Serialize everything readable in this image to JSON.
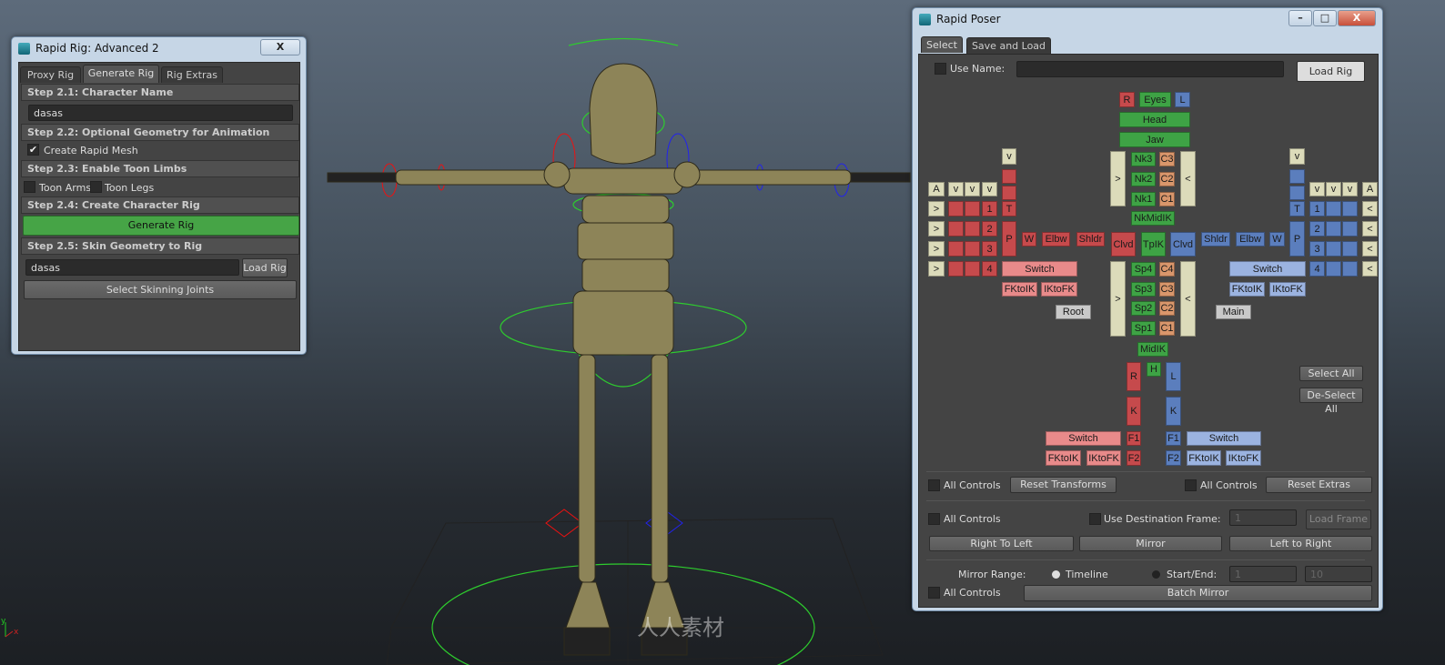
{
  "viewport": {
    "watermark": "人人素材",
    "axis_x": "x",
    "axis_y": "y"
  },
  "rig_window": {
    "title": "Rapid Rig: Advanced 2",
    "close": "X",
    "tabs": [
      {
        "label": "Proxy Rig"
      },
      {
        "label": "Generate Rig",
        "active": true
      },
      {
        "label": "Rig Extras"
      }
    ],
    "step1": "Step 2.1: Character Name",
    "name_value": "dasas",
    "step2": "Step 2.2: Optional Geometry for Animation",
    "rapid_mesh": "Create Rapid Mesh",
    "rapid_mesh_checked": true,
    "step3": "Step 2.3: Enable Toon Limbs",
    "toon_arms": "Toon Arms",
    "toon_legs": "Toon Legs",
    "step4": "Step 2.4: Create Character Rig",
    "generate": "Generate Rig",
    "step5": "Step 2.5: Skin Geometry to Rig",
    "skin_value": "dasas",
    "load_rig": "Load Rig",
    "select_joints": "Select Skinning Joints"
  },
  "poser_window": {
    "title": "Rapid Poser",
    "min": "–",
    "max": "□",
    "close": "X",
    "tabs": [
      {
        "label": "Select",
        "active": true
      },
      {
        "label": "Save and Load"
      }
    ],
    "use_name": "Use Name:",
    "use_name_value": "",
    "load_rig": "Load Rig",
    "colors": {
      "r": "#c64a4c",
      "g": "#3ea345",
      "b": "#5b7ebd",
      "o": "#d9966b",
      "y": "#dcdbba",
      "pr": "#e88a8a",
      "pb": "#9bb3e0",
      "gr": "#c9c9c9"
    },
    "buttons": [
      {
        "l": "R",
        "c": "r"
      },
      {
        "l": "Eyes",
        "c": "g"
      },
      {
        "l": "L",
        "c": "b"
      },
      {
        "l": "Head",
        "c": "g"
      },
      {
        "l": "Jaw",
        "c": "g"
      },
      {
        "l": ">",
        "c": "y"
      },
      {
        "l": "Nk3",
        "c": "g"
      },
      {
        "l": "Nk2",
        "c": "g"
      },
      {
        "l": "Nk1",
        "c": "g"
      },
      {
        "l": "C3",
        "c": "o"
      },
      {
        "l": "C2",
        "c": "o"
      },
      {
        "l": "C1",
        "c": "o"
      },
      {
        "l": "<",
        "c": "y"
      },
      {
        "l": "NkMidIK",
        "c": "g"
      },
      {
        "l": "Clvd",
        "c": "r"
      },
      {
        "l": "TpIK",
        "c": "g"
      },
      {
        "l": "Clvd",
        "c": "b"
      },
      {
        "l": "Shldr",
        "c": "r"
      },
      {
        "l": "Elbw",
        "c": "r"
      },
      {
        "l": "W",
        "c": "r"
      },
      {
        "l": "P",
        "c": "r"
      },
      {
        "l": "T",
        "c": "r"
      },
      {
        "l": "",
        "c": "r"
      },
      {
        "l": "",
        "c": "r"
      },
      {
        "l": "v",
        "c": "y"
      },
      {
        "l": "A",
        "c": "y"
      },
      {
        "l": "v",
        "c": "y"
      },
      {
        "l": "v",
        "c": "y"
      },
      {
        "l": "v",
        "c": "y"
      },
      {
        "l": ">",
        "c": "y"
      },
      {
        "l": ">",
        "c": "y"
      },
      {
        "l": ">",
        "c": "y"
      },
      {
        "l": ">",
        "c": "y"
      },
      {
        "l": "",
        "c": "r"
      },
      {
        "l": "",
        "c": "r"
      },
      {
        "l": "1",
        "c": "r"
      },
      {
        "l": "",
        "c": "r"
      },
      {
        "l": "",
        "c": "r"
      },
      {
        "l": "2",
        "c": "r"
      },
      {
        "l": "",
        "c": "r"
      },
      {
        "l": "",
        "c": "r"
      },
      {
        "l": "3",
        "c": "r"
      },
      {
        "l": "",
        "c": "r"
      },
      {
        "l": "",
        "c": "r"
      },
      {
        "l": "4",
        "c": "r"
      },
      {
        "l": "Switch",
        "c": "pr"
      },
      {
        "l": "FKtoIK",
        "c": "pr"
      },
      {
        "l": "IKtoFK",
        "c": "pr"
      },
      {
        "l": "Root",
        "c": "gr"
      },
      {
        "l": ">",
        "c": "y"
      },
      {
        "l": "Sp4",
        "c": "g"
      },
      {
        "l": "Sp3",
        "c": "g"
      },
      {
        "l": "Sp2",
        "c": "g"
      },
      {
        "l": "Sp1",
        "c": "g"
      },
      {
        "l": "C4",
        "c": "o"
      },
      {
        "l": "C3",
        "c": "o"
      },
      {
        "l": "C2",
        "c": "o"
      },
      {
        "l": "C1",
        "c": "o"
      },
      {
        "l": "<",
        "c": "y"
      },
      {
        "l": "v",
        "c": "y"
      },
      {
        "l": "",
        "c": "b"
      },
      {
        "l": "",
        "c": "b"
      },
      {
        "l": "T",
        "c": "b"
      },
      {
        "l": "P",
        "c": "b"
      },
      {
        "l": "Shldr",
        "c": "b"
      },
      {
        "l": "Elbw",
        "c": "b"
      },
      {
        "l": "W",
        "c": "b"
      },
      {
        "l": "v",
        "c": "y"
      },
      {
        "l": "v",
        "c": "y"
      },
      {
        "l": "v",
        "c": "y"
      },
      {
        "l": "A",
        "c": "y"
      },
      {
        "l": "1",
        "c": "b"
      },
      {
        "l": "",
        "c": "b"
      },
      {
        "l": "",
        "c": "b"
      },
      {
        "l": "<",
        "c": "y"
      },
      {
        "l": "2",
        "c": "b"
      },
      {
        "l": "",
        "c": "b"
      },
      {
        "l": "",
        "c": "b"
      },
      {
        "l": "<",
        "c": "y"
      },
      {
        "l": "3",
        "c": "b"
      },
      {
        "l": "",
        "c": "b"
      },
      {
        "l": "",
        "c": "b"
      },
      {
        "l": "<",
        "c": "y"
      },
      {
        "l": "4",
        "c": "b"
      },
      {
        "l": "",
        "c": "b"
      },
      {
        "l": "",
        "c": "b"
      },
      {
        "l": "<",
        "c": "y"
      },
      {
        "l": "Switch",
        "c": "pb"
      },
      {
        "l": "FKtoIK",
        "c": "pb"
      },
      {
        "l": "IKtoFK",
        "c": "pb"
      },
      {
        "l": "Main",
        "c": "gr"
      },
      {
        "l": "MidIK",
        "c": "g"
      },
      {
        "l": "R",
        "c": "r"
      },
      {
        "l": "H",
        "c": "g"
      },
      {
        "l": "L",
        "c": "b"
      },
      {
        "l": "K",
        "c": "r"
      },
      {
        "l": "K",
        "c": "b"
      },
      {
        "l": "Switch",
        "c": "pr"
      },
      {
        "l": "F1",
        "c": "r"
      },
      {
        "l": "F1",
        "c": "b"
      },
      {
        "l": "Switch",
        "c": "pb"
      },
      {
        "l": "FKtoIK",
        "c": "pr"
      },
      {
        "l": "IKtoFK",
        "c": "pr"
      },
      {
        "l": "F2",
        "c": "r"
      },
      {
        "l": "F2",
        "c": "b"
      },
      {
        "l": "FKtoIK",
        "c": "pb"
      },
      {
        "l": "IKtoFK",
        "c": "pb"
      }
    ],
    "select_all": "Select All",
    "deselect_all": "De-Select All",
    "all_controls": "All Controls",
    "reset_transforms": "Reset Transforms",
    "reset_extras": "Reset Extras",
    "use_dest": "Use Destination Frame:",
    "dest_value": "1",
    "load_frame": "Load Frame",
    "right_to_left": "Right To Left",
    "mirror": "Mirror",
    "left_to_right": "Left to Right",
    "mirror_range": "Mirror Range:",
    "timeline": "Timeline",
    "timeline_selected": true,
    "start_end": "Start/End:",
    "start_value": "1",
    "end_value": "10",
    "batch_mirror": "Batch Mirror"
  }
}
